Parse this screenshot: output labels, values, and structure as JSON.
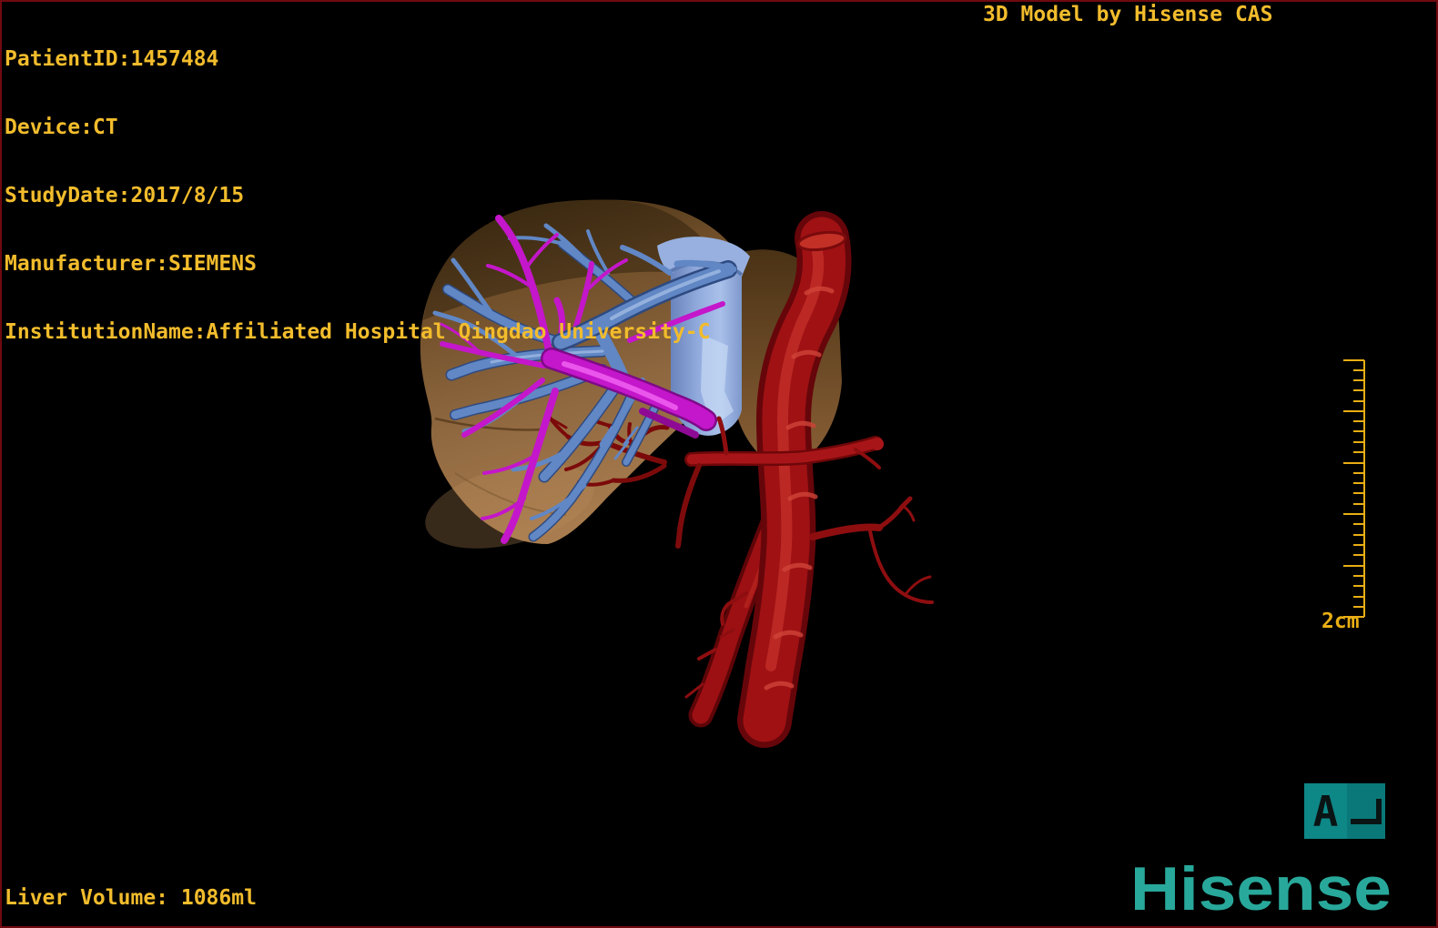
{
  "header": {
    "patient_lines": [
      "PatientID:1457484",
      "Device:CT",
      "StudyDate:2017/8/15",
      "Manufacturer:SIEMENS",
      "InstitutionName:Affiliated Hospital Qingdao University-C"
    ],
    "watermark": "3D Model by Hisense CAS"
  },
  "footer": {
    "liver_volume": "Liver Volume: 1086ml",
    "brand": "Hisense"
  },
  "scale": {
    "label": "2cm"
  },
  "orientation": {
    "letter": "A"
  },
  "colors": {
    "overlay_text": "#f2bc2c",
    "ruler": "#e9ae14",
    "brand_teal": "#28a89a",
    "badge_left": "#0e8787",
    "badge_right": "#0a7878",
    "frame": "#6e0a10",
    "liver": "#8a6238",
    "hepatic_vein_blue": "#6187c5",
    "portal_vein_magenta": "#c416ca",
    "vena_cava_blue": "#8ba4d8",
    "aorta_red": "#a01114",
    "hepatic_artery_dark_red": "#7c0a0a"
  },
  "model": {
    "parts": [
      "liver",
      "hepatic-veins",
      "portal-vein",
      "inferior-vena-cava",
      "aorta",
      "hepatic-artery"
    ]
  }
}
